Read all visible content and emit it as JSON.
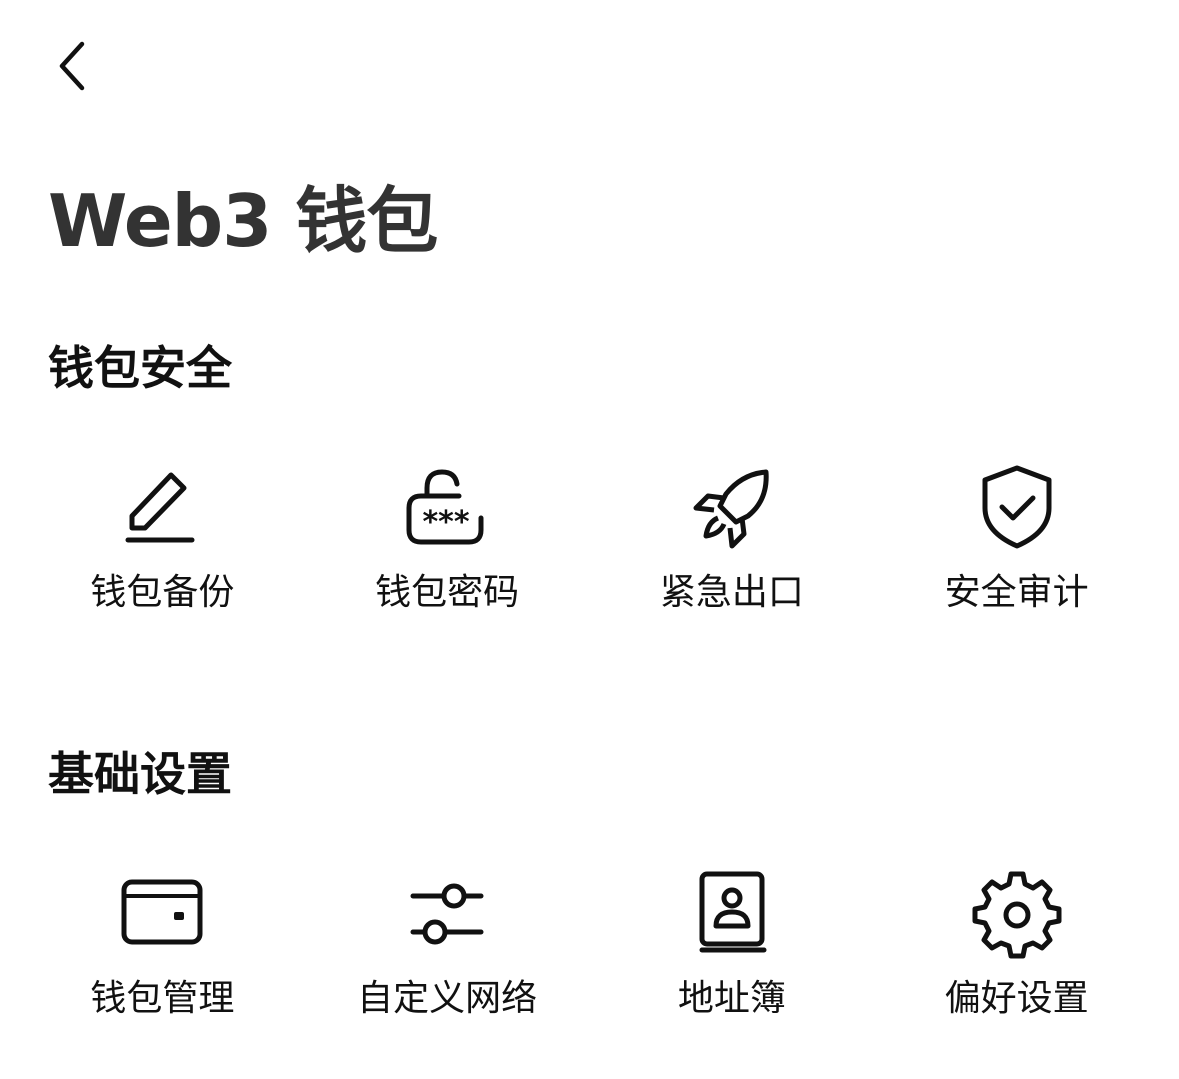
{
  "header": {
    "back_icon": "chevron-left-icon",
    "title": "Web3 钱包"
  },
  "sections": [
    {
      "title": "钱包安全",
      "items": [
        {
          "label": "钱包备份",
          "icon": "pencil-icon"
        },
        {
          "label": "钱包密码",
          "icon": "password-lock-icon"
        },
        {
          "label": "紧急出口",
          "icon": "rocket-icon"
        },
        {
          "label": "安全审计",
          "icon": "shield-check-icon"
        }
      ]
    },
    {
      "title": "基础设置",
      "items": [
        {
          "label": "钱包管理",
          "icon": "wallet-icon"
        },
        {
          "label": "自定义网络",
          "icon": "sliders-icon"
        },
        {
          "label": "地址簿",
          "icon": "address-book-icon"
        },
        {
          "label": "偏好设置",
          "icon": "gear-icon"
        }
      ]
    }
  ],
  "colors": {
    "title_text": "#333333",
    "text": "#111111",
    "background": "#ffffff"
  }
}
